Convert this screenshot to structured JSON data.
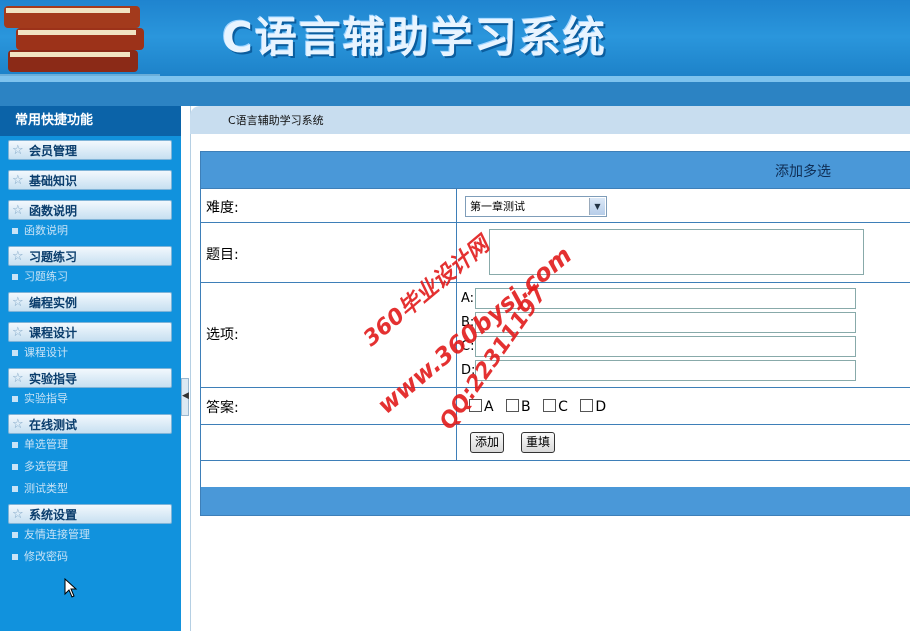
{
  "header": {
    "title": "C语言辅助学习系统"
  },
  "sidebar": {
    "title": "常用快捷功能",
    "sections": [
      {
        "label": "会员管理",
        "items": []
      },
      {
        "label": "基础知识",
        "items": []
      },
      {
        "label": "函数说明",
        "items": [
          "函数说明"
        ]
      },
      {
        "label": "习题练习",
        "items": [
          "习题练习"
        ]
      },
      {
        "label": "编程实例",
        "items": []
      },
      {
        "label": "课程设计",
        "items": [
          "课程设计"
        ]
      },
      {
        "label": "实验指导",
        "items": [
          "实验指导"
        ]
      },
      {
        "label": "在线测试",
        "items": [
          "单选管理",
          "多选管理",
          "测试类型"
        ]
      },
      {
        "label": "系统设置",
        "items": [
          "友情连接管理",
          "修改密码"
        ]
      }
    ]
  },
  "breadcrumb": "C语言辅助学习系统",
  "form": {
    "heading": "添加多选",
    "difficulty_label": "难度:",
    "difficulty_value": "第一章测试",
    "question_label": "题目:",
    "options_label": "选项:",
    "options": [
      {
        "letter": "A:",
        "value": ""
      },
      {
        "letter": "B:",
        "value": ""
      },
      {
        "letter": "C:",
        "value": ""
      },
      {
        "letter": "D:",
        "value": ""
      }
    ],
    "answer_label": "答案:",
    "answers": [
      "A",
      "B",
      "C",
      "D"
    ],
    "submit_label": "添加",
    "reset_label": "重填"
  },
  "watermark": {
    "line1": "360毕业设计网",
    "line2": "www.360bysj.com",
    "line3": "QQ:22311197"
  },
  "colors": {
    "header": "#1f84cf",
    "sidebar": "#1192dd",
    "panel_bar": "#4a98d8",
    "watermark": "#e21b1b"
  }
}
